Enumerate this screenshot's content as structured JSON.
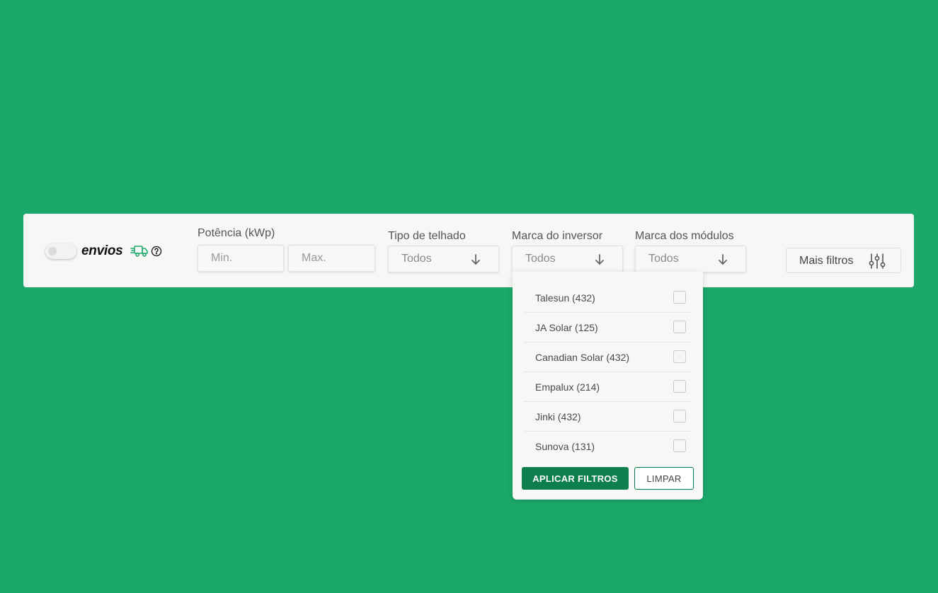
{
  "filter_bar": {
    "shipping_toggle": {
      "label": "envios",
      "enabled": false
    },
    "power": {
      "label": "Potência (kWp)",
      "min_placeholder": "Min.",
      "max_placeholder": "Max."
    },
    "roof_type": {
      "label": "Tipo de telhado",
      "value": "Todos"
    },
    "inverter_brand": {
      "label": "Marca do inversor",
      "value": "Todos"
    },
    "module_brand": {
      "label": "Marca dos módulos",
      "value": "Todos"
    },
    "more_filters": {
      "label": "Mais filtros"
    }
  },
  "dropdown": {
    "items": [
      {
        "label": "Talesun (432)",
        "checked": false
      },
      {
        "label": "JA Solar (125)",
        "checked": false
      },
      {
        "label": "Canadian Solar (432)",
        "checked": false
      },
      {
        "label": "Empalux (214)",
        "checked": false
      },
      {
        "label": "Jinki (432)",
        "checked": false
      },
      {
        "label": "Sunova (131)",
        "checked": false
      }
    ],
    "apply_label": "APLICAR FILTROS",
    "clear_label": "LIMPAR"
  },
  "colors": {
    "background": "#1ca86a",
    "accent": "#0d7f4d",
    "truck_icon": "#1ca86a"
  },
  "icons": [
    "truck-icon",
    "help-icon",
    "arrow-down-icon",
    "sliders-icon"
  ]
}
